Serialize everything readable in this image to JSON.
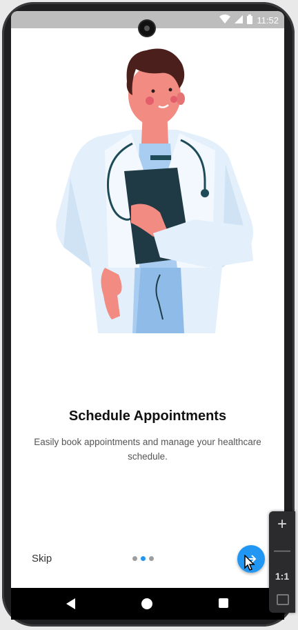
{
  "status_bar": {
    "time": "11:52",
    "icons": [
      "wifi-icon",
      "signal-icon",
      "battery-icon"
    ]
  },
  "onboarding": {
    "title": "Schedule Appointments",
    "description": "Easily book appointments and manage your healthcare schedule.",
    "skip_label": "Skip",
    "page_indicator": {
      "total": 3,
      "active": 2
    },
    "next_icon": "arrow-right-icon"
  },
  "emulator_zoom": {
    "zoom_in": "+",
    "zoom_out": "—",
    "ratio": "1:1"
  },
  "colors": {
    "accent": "#2196f3",
    "status_bar": "#bdbdbd",
    "nav_bar": "#000000"
  }
}
